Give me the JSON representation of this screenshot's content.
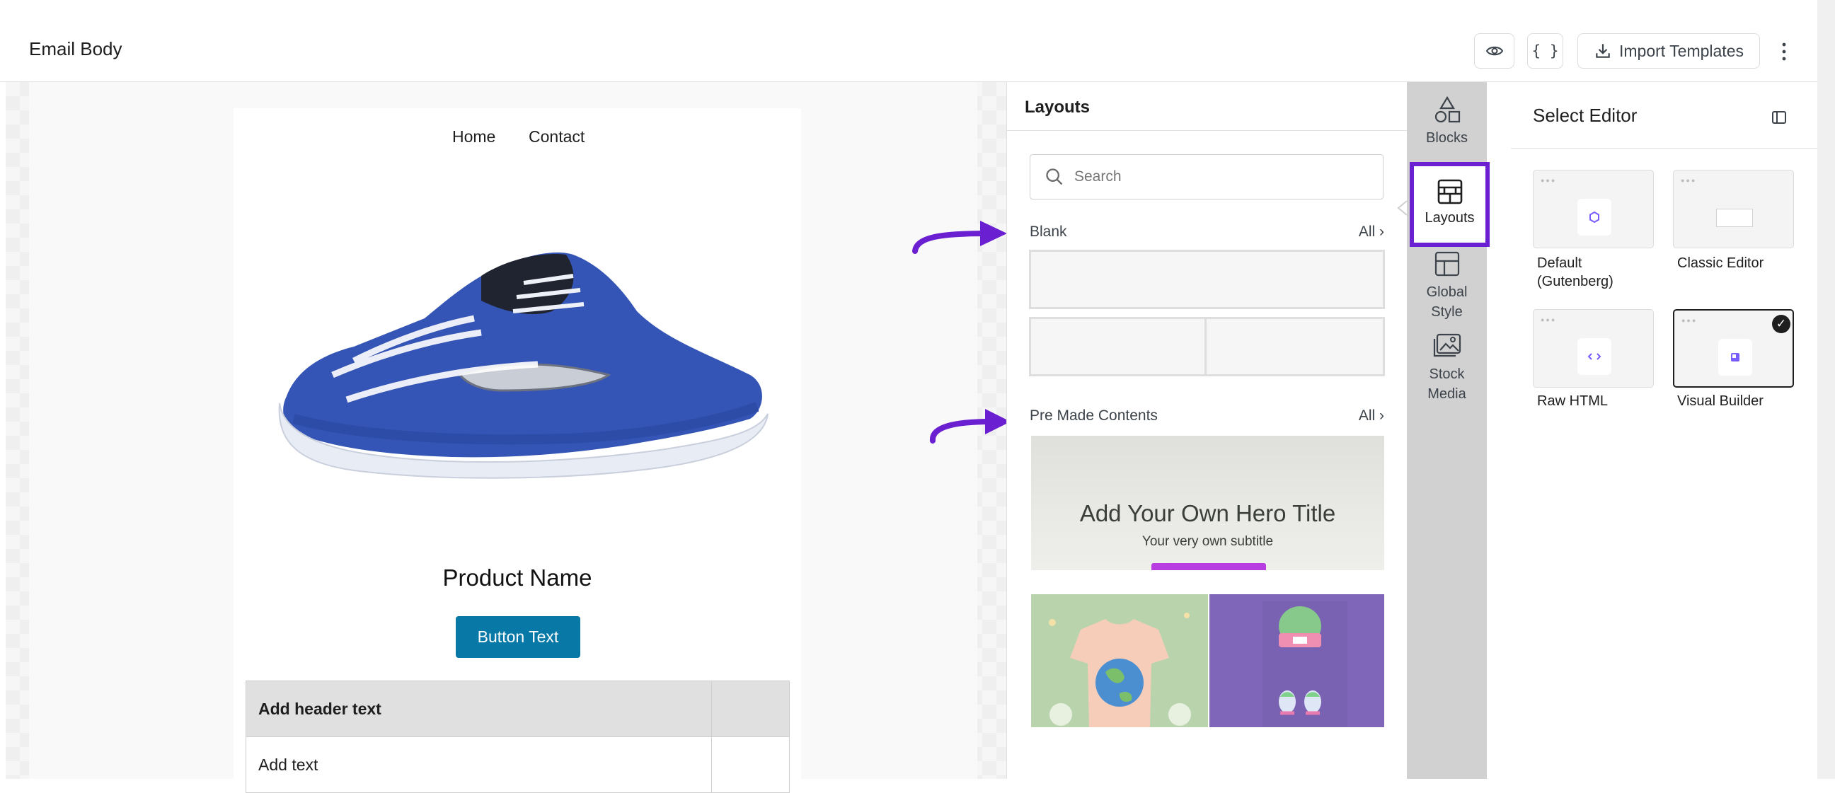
{
  "header": {
    "title": "Email Body",
    "import_label": "Import Templates"
  },
  "email": {
    "nav": [
      "Home",
      "Contact"
    ],
    "product_name": "Product Name",
    "button_text": "Button Text",
    "table": {
      "header_text": "Add header text",
      "row_text": "Add text"
    }
  },
  "layouts_panel": {
    "title": "Layouts",
    "search_placeholder": "Search",
    "blank_label": "Blank",
    "all_label": "All",
    "premade_label": "Pre Made Contents",
    "hero_title": "Add Your Own Hero Title",
    "hero_subtitle": "Your very own subtitle"
  },
  "rail": {
    "blocks": "Blocks",
    "layouts": "Layouts",
    "global_style": "Global Style",
    "stock_media": "Stock Media"
  },
  "editor": {
    "title": "Select Editor",
    "options": [
      "Default (Gutenberg)",
      "Classic Editor",
      "Raw HTML",
      "Visual Builder"
    ],
    "selected": "Visual Builder"
  },
  "colors": {
    "accent_purple": "#6a1fd0",
    "button_blue": "#0878a7",
    "hero_bar": "#b73de0"
  }
}
